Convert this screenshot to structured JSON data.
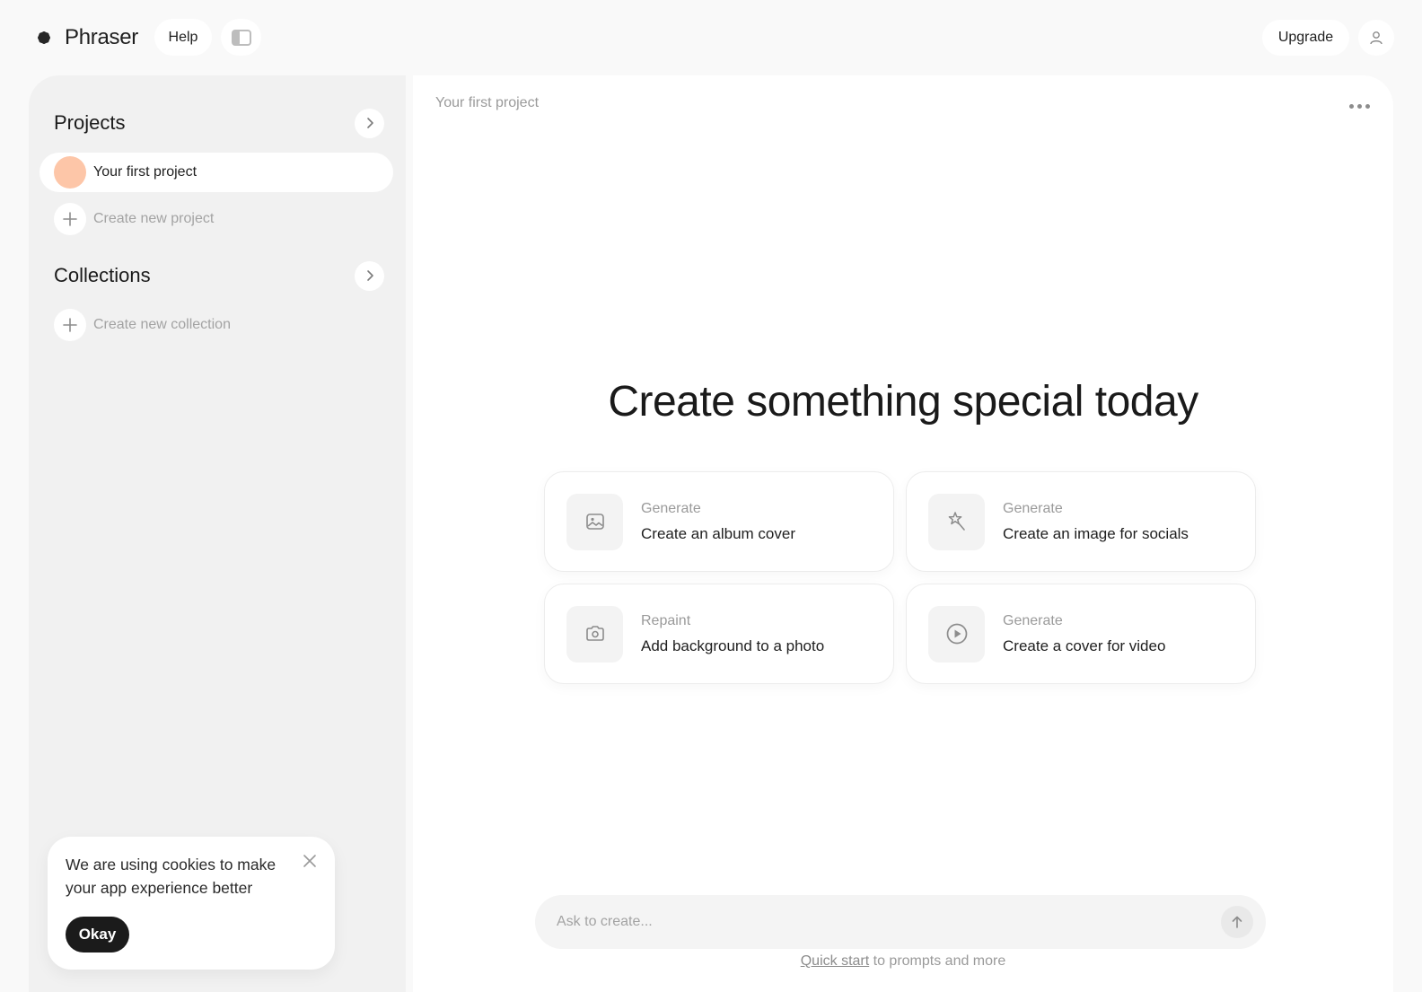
{
  "app": {
    "name": "Phraser",
    "logo_icon": "flower-asterisk-icon"
  },
  "topbar": {
    "help_label": "Help",
    "panel_toggle_icon": "sidebar-toggle-icon",
    "upgrade_label": "Upgrade",
    "user_icon": "user-icon"
  },
  "sidebar": {
    "projects": {
      "title": "Projects",
      "items": [
        {
          "label": "Your first project",
          "avatar_color": "#fdc6a8",
          "selected": true
        }
      ],
      "create_label": "Create new project"
    },
    "collections": {
      "title": "Collections",
      "items": [],
      "create_label": "Create new collection"
    }
  },
  "main": {
    "breadcrumb": "Your first project",
    "more_icon": "more-horizontal-icon",
    "hero_title": "Create something special today",
    "cards": [
      {
        "kind": "Generate",
        "title": "Create an album cover",
        "icon": "image-icon"
      },
      {
        "kind": "Generate",
        "title": "Create an image for socials",
        "icon": "magic-wand-icon"
      },
      {
        "kind": "Repaint",
        "title": "Add background to a photo",
        "icon": "camera-icon"
      },
      {
        "kind": "Generate",
        "title": "Create a cover for video",
        "icon": "play-circle-icon"
      }
    ],
    "ask": {
      "placeholder": "Ask to create...",
      "value": "",
      "send_icon": "arrow-up-icon"
    },
    "quick_start": {
      "link_label": "Quick start",
      "suffix": " to prompts and more"
    }
  },
  "cookie_banner": {
    "message": "We are using cookies to make your app experience better",
    "button_label": "Okay",
    "close_icon": "close-icon"
  },
  "colors": {
    "background": "#f9f9f9",
    "sidebar_bg": "#f1f1f1",
    "primary_dark": "#1b1b1b",
    "muted_text": "#9a9a9a",
    "project_avatar": "#fdc6a8"
  }
}
